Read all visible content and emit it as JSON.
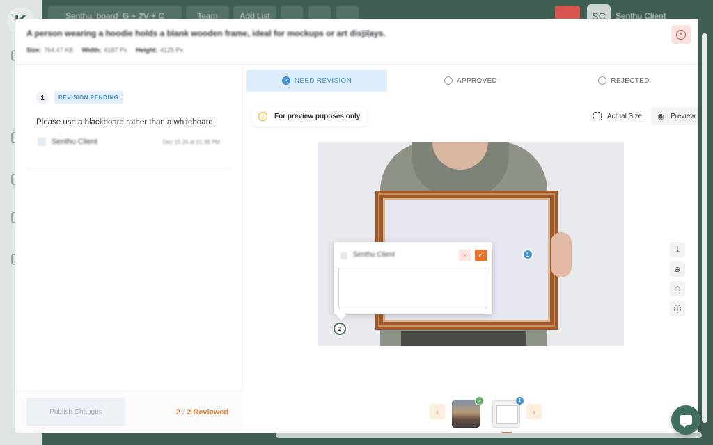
{
  "background": {
    "board_label": "Senthu_board",
    "board_shortcut": "G + 2V + C",
    "team_label": "Team",
    "add_list_label": "Add List",
    "avatar_initials": "SC",
    "user_name": "Senthu Client"
  },
  "modal": {
    "title": "A person wearing a hoodie holds a blank wooden frame, ideal for mockups or art displays.",
    "meta": {
      "size_label": "Size:",
      "size_value": "764.47 KB",
      "width_label": "Width:",
      "width_value": "6187 Px",
      "height_label": "Height:",
      "height_value": "4125 Px"
    }
  },
  "revision": {
    "number": "1",
    "status": "REVISION PENDING",
    "comment": "Please use a blackboard rather than a whiteboard.",
    "author": "Senthu Client",
    "timestamp": "Dec 15 24 at 01:38 PM"
  },
  "footer": {
    "publish_label": "Publish Changes",
    "reviewed_count": "2",
    "reviewed_total": "2",
    "reviewed_label": "Reviewed"
  },
  "tabs": [
    {
      "label": "NEED REVISION",
      "active": true
    },
    {
      "label": "APPROVED",
      "active": false
    },
    {
      "label": "REJECTED",
      "active": false
    }
  ],
  "preview_note": "For preview puposes only",
  "tools": {
    "actual_size": "Actual Size",
    "preview": "Preview"
  },
  "markers": {
    "one": "1",
    "two": "2"
  },
  "popup": {
    "author": "Senthu Client",
    "textarea_value": ""
  },
  "thumbnails": {
    "second_badge": "1"
  },
  "colors": {
    "accent_blue": "#3e91d4",
    "accent_orange": "#e8732a",
    "brand_green": "#3f5e54",
    "danger_red": "#d0493c"
  },
  "icons": {
    "close": "close-circle-icon",
    "copy": "copy-icon",
    "check": "check-circle-icon",
    "warning": "info-warning-icon",
    "fullscreen": "fullscreen-icon",
    "eye": "eye-icon",
    "download": "download-icon",
    "zoom_in": "zoom-in-icon",
    "zoom_out": "zoom-out-icon",
    "info": "info-icon",
    "chat": "chat-icon"
  }
}
